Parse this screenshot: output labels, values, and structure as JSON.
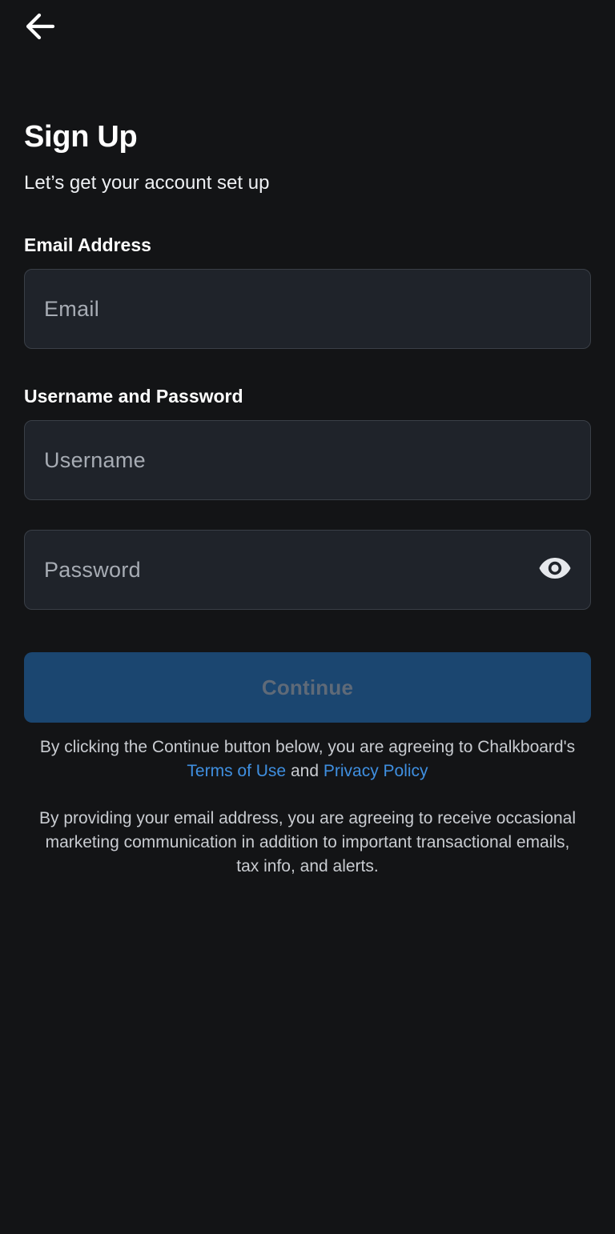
{
  "header": {
    "back_icon": "arrow-left-icon"
  },
  "page": {
    "title": "Sign Up",
    "subtitle": "Let’s get your account set up"
  },
  "email_section": {
    "label": "Email Address",
    "email_placeholder": "Email",
    "email_value": ""
  },
  "credentials_section": {
    "label": "Username and Password",
    "username_placeholder": "Username",
    "username_value": "",
    "password_placeholder": "Password",
    "password_value": "",
    "visibility_icon": "eye-icon"
  },
  "actions": {
    "continue_label": "Continue",
    "continue_enabled": false
  },
  "legal": {
    "terms_prefix": "By clicking the Continue button below, you are agreeing to Chalkboard's",
    "terms_link": "Terms of Use",
    "and_text": "and",
    "privacy_link": "Privacy Policy",
    "marketing_notice": "By providing your email address, you are agreeing to receive occasional marketing communication in addition to important transactional emails, tax info, and alerts."
  },
  "colors": {
    "background": "#131416",
    "field_background": "#1f232a",
    "field_border": "#3a3f47",
    "button_disabled_bg": "#1b4670",
    "button_disabled_text": "#5f6a78",
    "link": "#3f8fe0"
  }
}
